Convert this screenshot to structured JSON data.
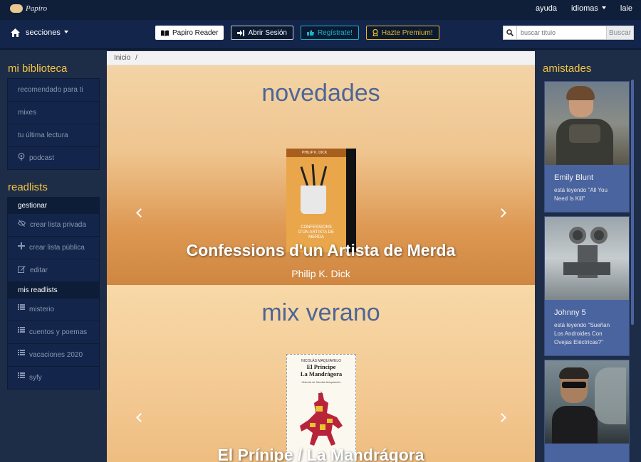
{
  "app": {
    "logo_text": "Papiro"
  },
  "topbar": {
    "links": [
      "ayuda",
      "idiomas",
      "laie"
    ]
  },
  "navbar": {
    "sections_label": "secciones",
    "buttons": {
      "reader": "Papiro Reader",
      "login": "Abrir Sesión",
      "register": "Regístrate!",
      "premium": "Hazte Premium!"
    },
    "search_placeholder": "buscar título",
    "search_button": "Buscar"
  },
  "left_sidebar": {
    "library_heading": "mi biblioteca",
    "library_items": [
      "recomendado para ti",
      "mixes",
      "tu última lectura",
      "podcast"
    ],
    "readlists_heading": "readlists",
    "manage_label": "gestionar",
    "manage_items": [
      "crear lista privada",
      "crear lista pública",
      "editar"
    ],
    "my_readlists_label": "mis readlists",
    "readlists": [
      "misterio",
      "cuentos y poemas",
      "vacaciones 2020",
      "syfy"
    ]
  },
  "breadcrumb": {
    "home": "Inicio",
    "separator": "/"
  },
  "carousels": [
    {
      "heading": "novedades",
      "book_title": "Confessions d'un Artista de Merda",
      "author": "Philip K. Dick",
      "cover_author": "PHILIP K. DICK",
      "cover_title": "CONFESSIONS D'UN ARTISTA DE MERDA",
      "slide_count": 5,
      "active_slide": 1
    },
    {
      "heading": "mix verano",
      "book_title": "El Prínipe / La Mandrágora",
      "cover_author": "NICOLÁS MAQUIAVELO",
      "cover_title_line1": "El Príncipe",
      "cover_title_line2": "La Mandrágora",
      "cover_subtitle": "Historia de Nicolás Maquiavelo"
    }
  ],
  "right_sidebar": {
    "heading": "amistades",
    "friends": [
      {
        "name": "Emily Blunt",
        "reading": "está leyendo \"All You Need Is Kill\""
      },
      {
        "name": "Johnny 5",
        "reading": "está leyendo \"Sueñan Los Androides Con Ovejas Eléctricas?\""
      },
      {
        "name": "",
        "reading": ""
      }
    ]
  },
  "colors": {
    "accent_heading": "#f5c542",
    "carousel_title": "#4c6597",
    "friend_card": "#4a64a0",
    "nav_bg": "#13254a"
  }
}
